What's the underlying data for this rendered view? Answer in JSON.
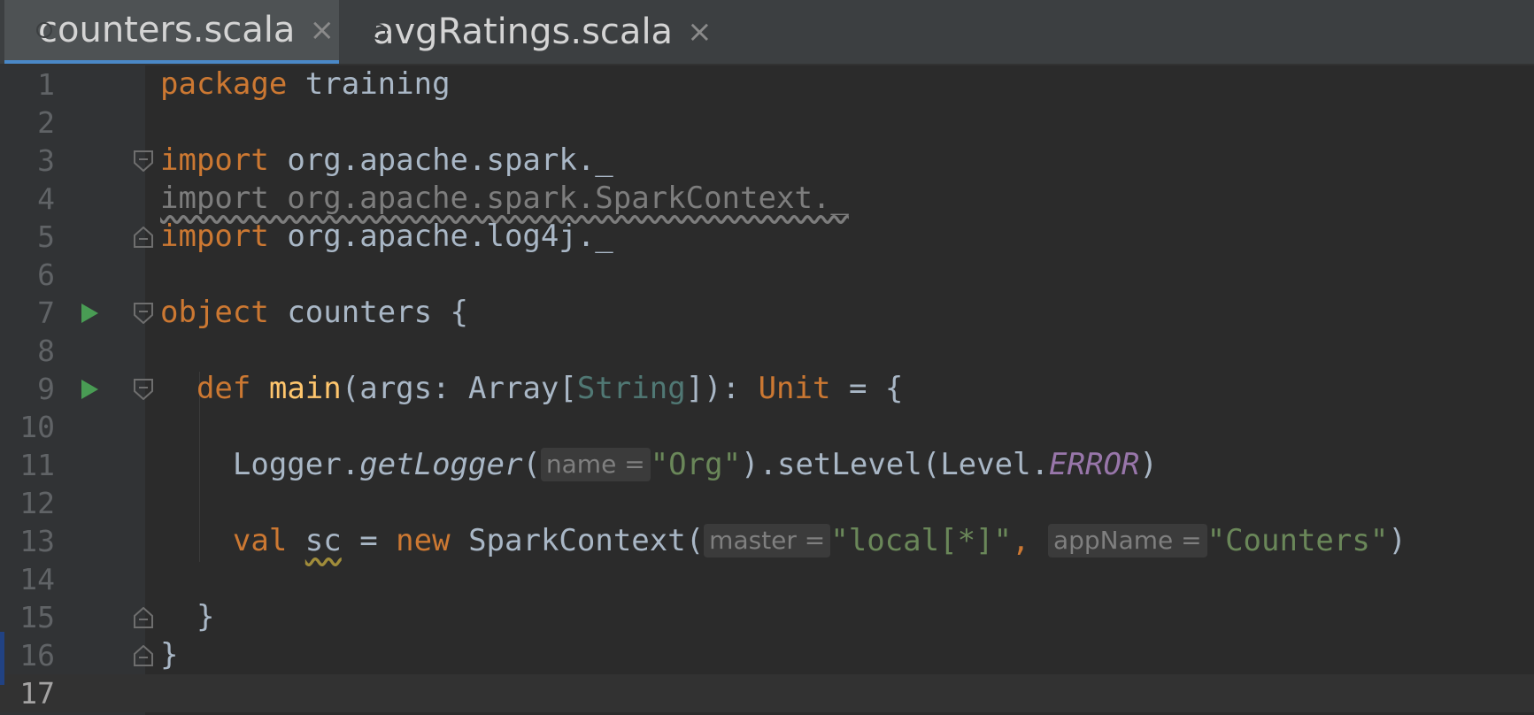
{
  "tabs": [
    {
      "label": "counters.scala",
      "active": true
    },
    {
      "label": "avgRatings.scala",
      "active": false
    }
  ],
  "tab_close_glyph": "×",
  "editor": {
    "current_line": 17,
    "lines": [
      {
        "num": "1",
        "text": "package training"
      },
      {
        "num": "2",
        "text": ""
      },
      {
        "num": "3",
        "text": "import org.apache.spark._"
      },
      {
        "num": "4",
        "text": "import org.apache.spark.SparkContext._"
      },
      {
        "num": "5",
        "text": "import org.apache.log4j._"
      },
      {
        "num": "6",
        "text": ""
      },
      {
        "num": "7",
        "text": "object counters {"
      },
      {
        "num": "8",
        "text": ""
      },
      {
        "num": "9",
        "text": "def main(args: Array[String]): Unit = {"
      },
      {
        "num": "10",
        "text": ""
      },
      {
        "num": "11",
        "text": "Logger.getLogger(\"Org\").setLevel(Level.ERROR)"
      },
      {
        "num": "12",
        "text": ""
      },
      {
        "num": "13",
        "text": "val sc = new SparkContext(\"local[*]\", \"Counters\")"
      },
      {
        "num": "14",
        "text": ""
      },
      {
        "num": "15",
        "text": "}"
      },
      {
        "num": "16",
        "text": "}"
      },
      {
        "num": "17",
        "text": ""
      }
    ],
    "tokens": {
      "package_kw": "package",
      "package_name": "training",
      "import_kw": "import",
      "import1_path": "org.apache.spark._",
      "import2_full": "import org.apache.spark.SparkContext._",
      "import3_path": "org.apache.log4j._",
      "object_kw": "object",
      "object_name": "counters {",
      "def_kw": "def",
      "main_fn": "main",
      "main_params_a": "(args: Array[",
      "main_params_type": "String",
      "main_params_b": "]): ",
      "unit_type": "Unit",
      "main_tail": " = {",
      "logger_obj": "Logger.",
      "get_logger_fn": "getLogger",
      "open_paren": "(",
      "hint_name": "name =",
      "str_org": "\"Org\"",
      "set_level": ").setLevel(Level.",
      "error_const": "ERROR",
      "close_paren": ")",
      "val_kw": "val",
      "sc_var": "sc",
      "eq": " = ",
      "new_kw": "new",
      "spark_ctx": " SparkContext(",
      "hint_master": "master =",
      "str_local": "\"local[*]\"",
      "comma": ", ",
      "hint_appname": "appName =",
      "str_counters": "\"Counters\"",
      "close_brace": "}"
    }
  }
}
